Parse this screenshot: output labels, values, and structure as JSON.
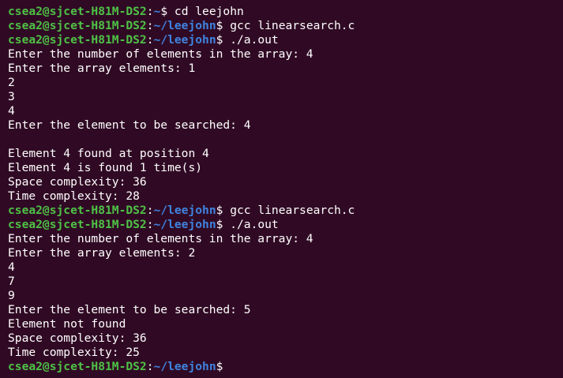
{
  "terminal": {
    "lines": [
      {
        "kind": "prompt",
        "user": "csea2@sjcet-H81M-DS2",
        "path": "~",
        "sym": "$ ",
        "cmd": "cd leejohn"
      },
      {
        "kind": "prompt",
        "user": "csea2@sjcet-H81M-DS2",
        "path": "~/leejohn",
        "sym": "$ ",
        "cmd": "gcc linearsearch.c"
      },
      {
        "kind": "prompt",
        "user": "csea2@sjcet-H81M-DS2",
        "path": "~/leejohn",
        "sym": "$ ",
        "cmd": "./a.out"
      },
      {
        "kind": "output",
        "text": "Enter the number of elements in the array: 4"
      },
      {
        "kind": "output",
        "text": "Enter the array elements: 1"
      },
      {
        "kind": "output",
        "text": "2"
      },
      {
        "kind": "output",
        "text": "3"
      },
      {
        "kind": "output",
        "text": "4"
      },
      {
        "kind": "output",
        "text": "Enter the element to be searched: 4"
      },
      {
        "kind": "output",
        "text": ""
      },
      {
        "kind": "output",
        "text": "Element 4 found at position 4"
      },
      {
        "kind": "output",
        "text": "Element 4 is found 1 time(s)"
      },
      {
        "kind": "output",
        "text": "Space complexity: 36"
      },
      {
        "kind": "output",
        "text": "Time complexity: 28"
      },
      {
        "kind": "prompt",
        "user": "csea2@sjcet-H81M-DS2",
        "path": "~/leejohn",
        "sym": "$ ",
        "cmd": "gcc linearsearch.c"
      },
      {
        "kind": "prompt",
        "user": "csea2@sjcet-H81M-DS2",
        "path": "~/leejohn",
        "sym": "$ ",
        "cmd": "./a.out"
      },
      {
        "kind": "output",
        "text": "Enter the number of elements in the array: 4"
      },
      {
        "kind": "output",
        "text": "Enter the array elements: 2"
      },
      {
        "kind": "output",
        "text": "4"
      },
      {
        "kind": "output",
        "text": "7"
      },
      {
        "kind": "output",
        "text": "9"
      },
      {
        "kind": "output",
        "text": "Enter the element to be searched: 5"
      },
      {
        "kind": "output",
        "text": "Element not found"
      },
      {
        "kind": "output",
        "text": "Space complexity: 36"
      },
      {
        "kind": "output",
        "text": "Time complexity: 25"
      },
      {
        "kind": "prompt",
        "user": "csea2@sjcet-H81M-DS2",
        "path": "~/leejohn",
        "sym": "$",
        "cmd": ""
      }
    ]
  },
  "colors": {
    "background": "#300a24",
    "user": "#4ec246",
    "path": "#3f83e0",
    "text": "#ffffff"
  }
}
